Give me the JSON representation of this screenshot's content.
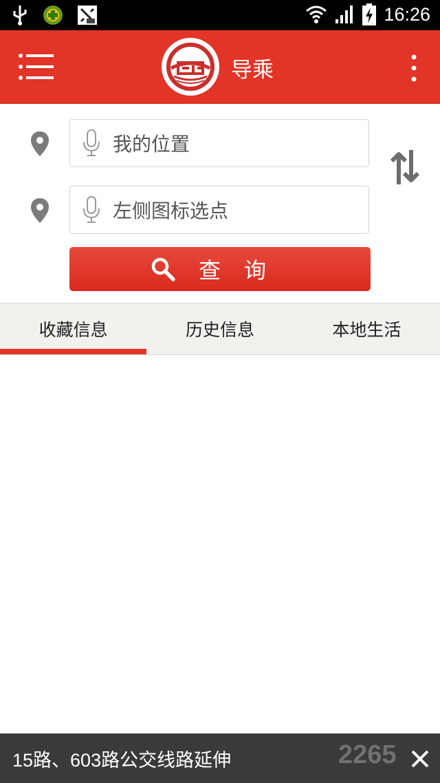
{
  "status_bar": {
    "time": "16:26",
    "icons": [
      "usb-icon",
      "app-notification-icon",
      "wrench-notification-icon",
      "wifi-icon",
      "signal-icon",
      "battery-charging-icon"
    ]
  },
  "header": {
    "title": "导乘",
    "logo_icon": "transit-logo-icon",
    "menu_icon": "menu-icon",
    "more_icon": "more-vertical-icon"
  },
  "route": {
    "from_placeholder": "我的位置",
    "to_placeholder": "左侧图标选点",
    "pin_icon": "location-pin-icon",
    "mic_icon": "microphone-icon",
    "swap_icon": "swap-icon"
  },
  "query_button": {
    "label": "查询",
    "icon": "search-icon"
  },
  "tabs": [
    {
      "label": "收藏信息",
      "active": true
    },
    {
      "label": "历史信息",
      "active": false
    },
    {
      "label": "本地生活",
      "active": false
    }
  ],
  "notice": {
    "text": "15路、603路公交线路延伸",
    "close_icon": "close-icon"
  },
  "watermark": {
    "text": "2265"
  },
  "colors": {
    "brand_red": "#e23427",
    "status_bar": "#000000",
    "notice_bg": "#3a3a3a",
    "tab_bg": "#f2f1ee"
  }
}
